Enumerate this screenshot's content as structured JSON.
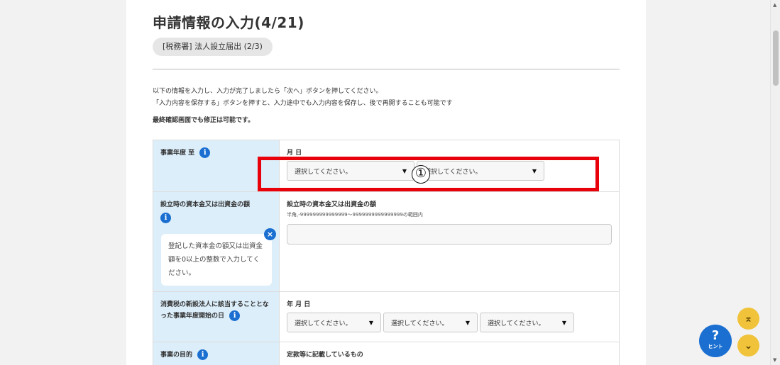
{
  "page": {
    "title": "申請情報の入力(4/21)",
    "section_pill": "[税務署] 法人設立届出 (2/3)",
    "intro_line1": "以下の情報を入力し、入力が完了しましたら「次へ」ボタンを押してください。",
    "intro_line2": "「入力内容を保存する」ボタンを押すと、入力途中でも入力内容を保存し、後で再開することも可能です",
    "intro_note": "最終確認画面でも修正は可能です。"
  },
  "form": {
    "row1": {
      "label": "事業年度 至",
      "field_header": "月 日",
      "select_month": "選択してください。",
      "select_day": "選択してください。"
    },
    "row2": {
      "label": "設立時の資本金又は出資金の額",
      "tooltip": "登記した資本金の額又は出資金額を0以上の整数で入力してください。",
      "field_header": "設立時の資本金又は出資金の額",
      "field_sub": "半角,-999999999999999～9999999999999999の範囲内",
      "input_value": ""
    },
    "row3": {
      "label": "消費税の新設法人に該当することとなった事業年度開始の日",
      "field_header": "年 月 日",
      "select_year": "選択してください。",
      "select_month": "選択してください。",
      "select_day": "選択してください。"
    },
    "row4": {
      "label": "事業の目的",
      "field_header": "定款等に記載しているもの"
    }
  },
  "annotation": {
    "marker": "①"
  },
  "icons": {
    "info": "i",
    "close": "×",
    "arrow": "▼",
    "scroll_top": "⌅",
    "scroll_bottom": "⌄"
  },
  "hint": {
    "symbol": "?",
    "label": "ヒント"
  },
  "colors": {
    "accent": "#1a6fd1",
    "label_bg": "#dceefa",
    "highlight": "#e8000b",
    "nav_btn": "#f0c33a"
  }
}
